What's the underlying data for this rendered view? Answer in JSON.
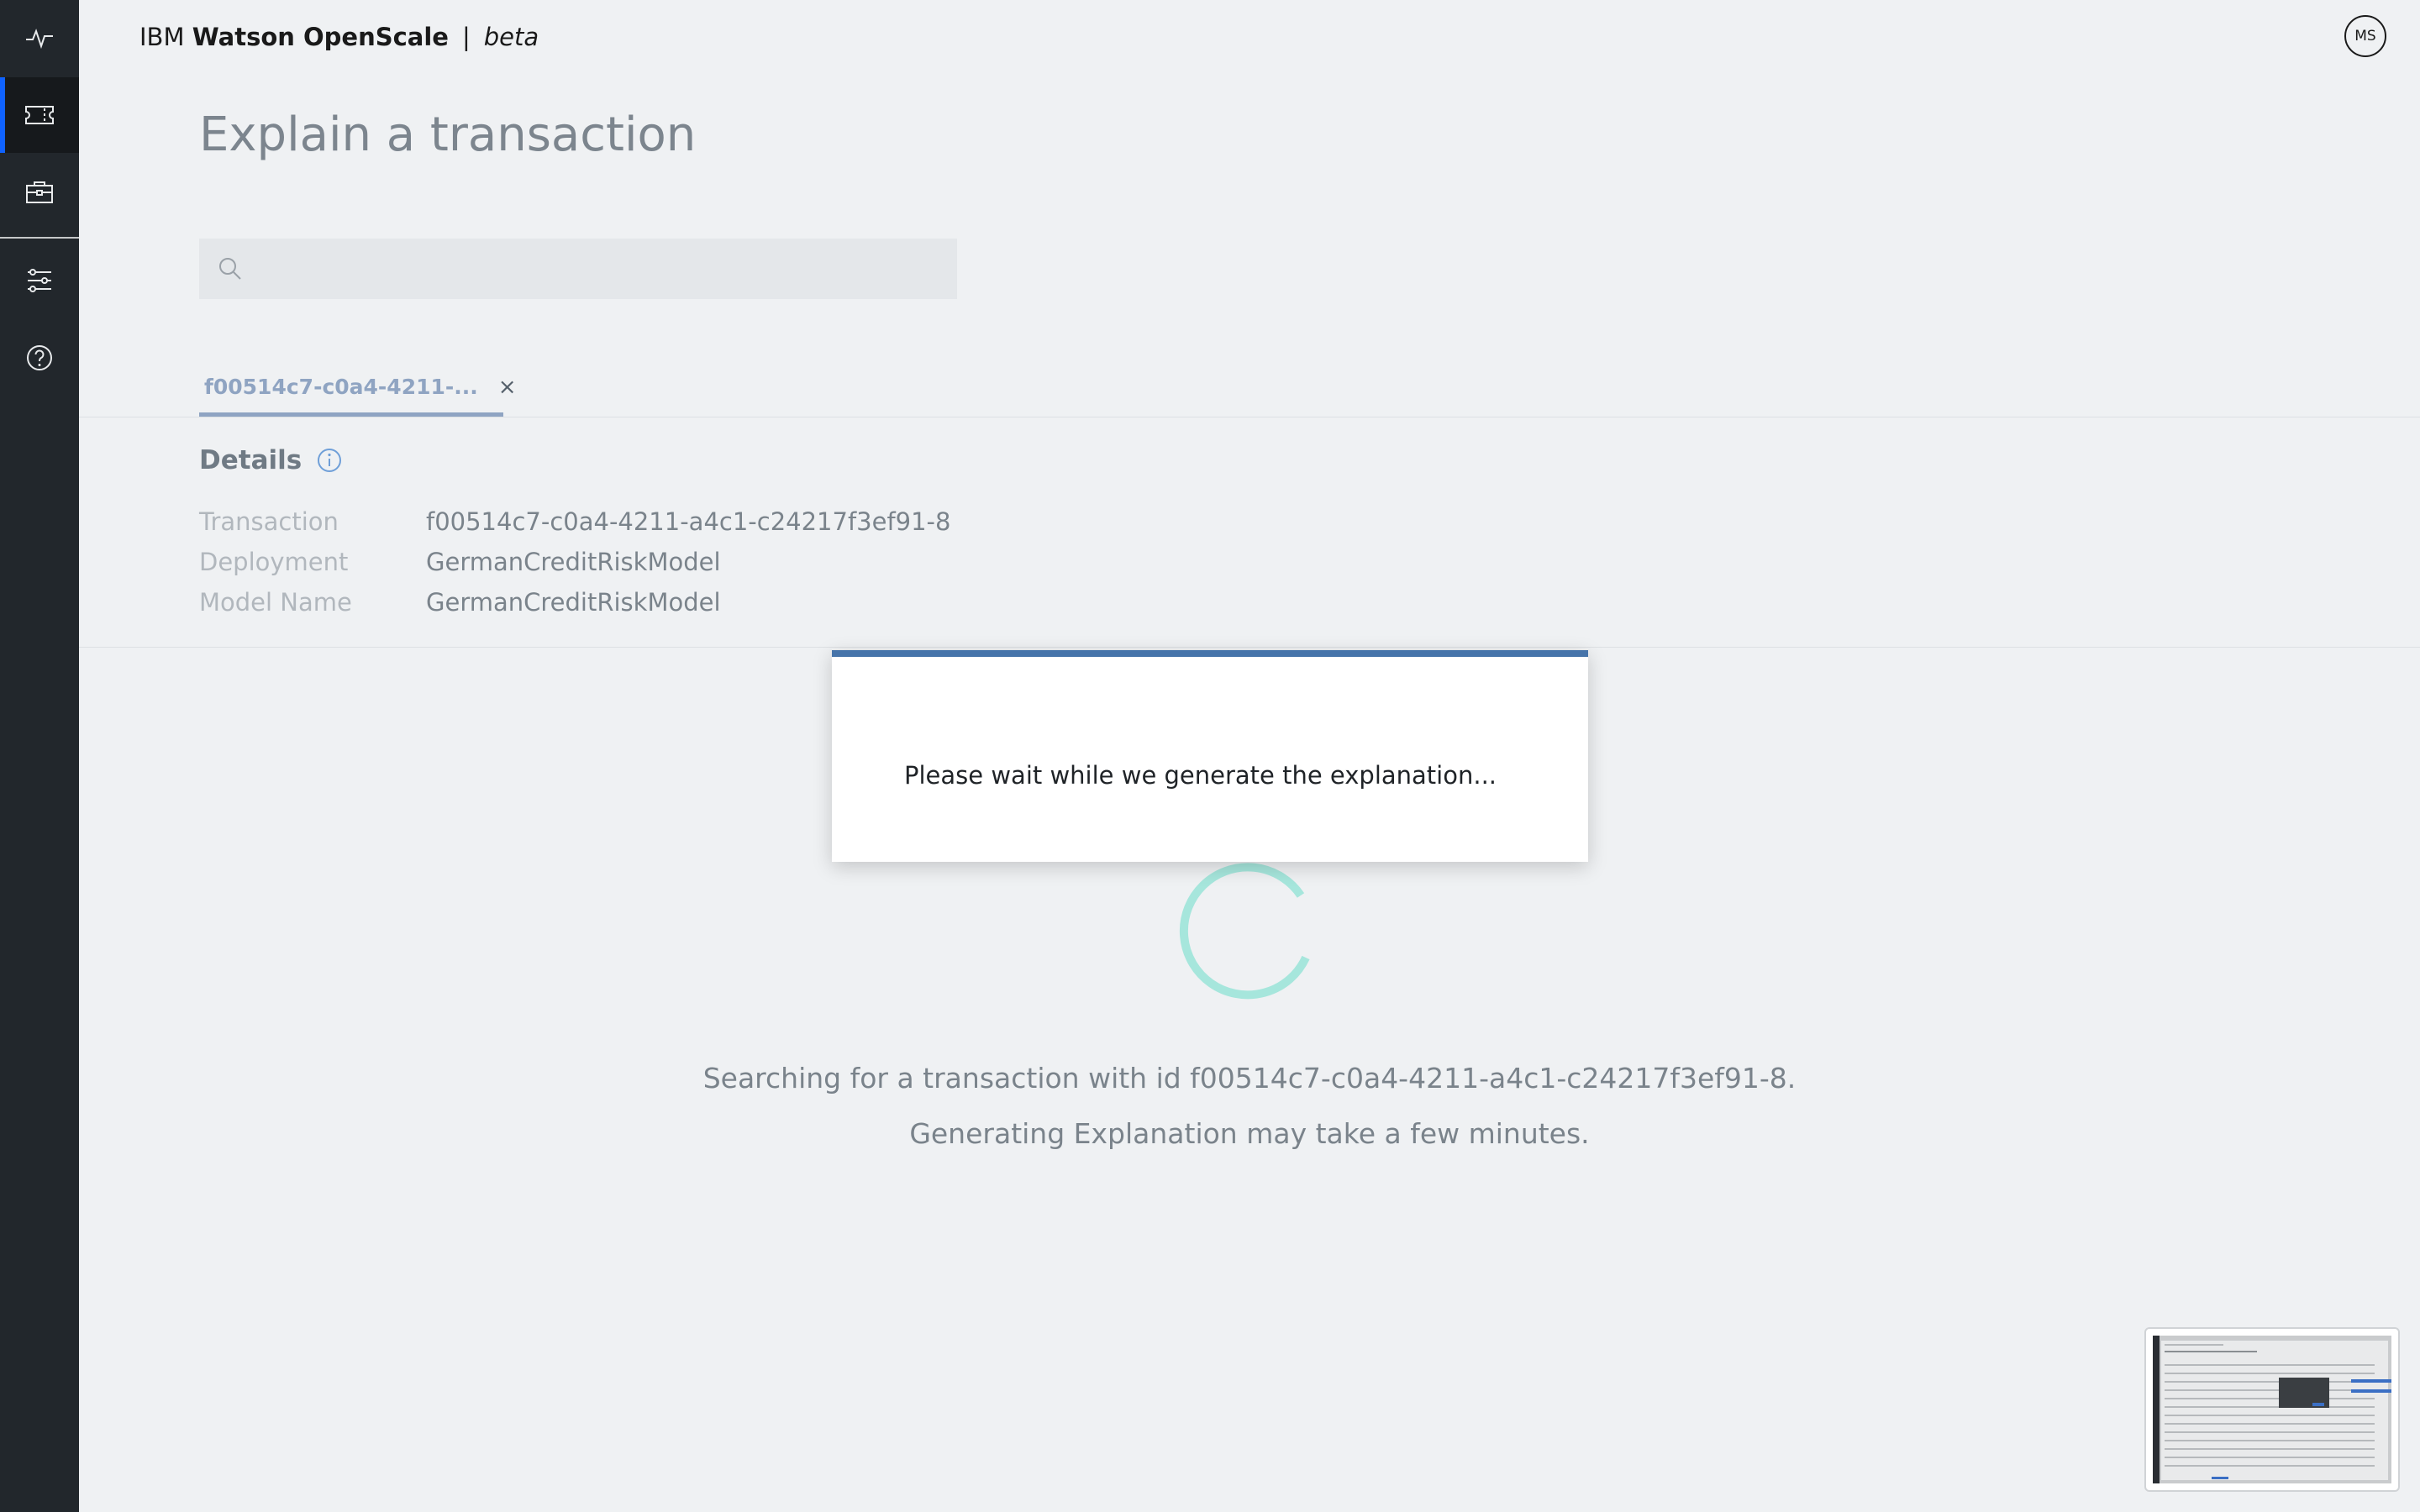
{
  "app": {
    "brand_prefix": "IBM",
    "brand_name": "Watson OpenScale",
    "brand_separator": "|",
    "brand_tag": "beta",
    "user_initials": "MS"
  },
  "rail": {
    "items": [
      {
        "icon": "pulse-icon"
      },
      {
        "icon": "ticket-icon"
      },
      {
        "icon": "briefcase-icon"
      },
      {
        "icon": "sliders-icon"
      },
      {
        "icon": "help-icon"
      }
    ]
  },
  "page": {
    "title": "Explain a transaction"
  },
  "search": {
    "value": "",
    "placeholder": ""
  },
  "tab": {
    "label": "f00514c7-c0a4-4211-...",
    "close": "×"
  },
  "details": {
    "title": "Details",
    "rows": [
      {
        "key": "Transaction",
        "value": "f00514c7-c0a4-4211-a4c1-c24217f3ef91-8"
      },
      {
        "key": "Deployment",
        "value": "GermanCreditRiskModel"
      },
      {
        "key": "Model Name",
        "value": "GermanCreditRiskModel"
      }
    ]
  },
  "status": {
    "line1": "Searching for a transaction with id f00514c7-c0a4-4211-a4c1-c24217f3ef91-8.",
    "line2": "Generating Explanation may take a few minutes."
  },
  "modal": {
    "message": "Please wait while we generate the explanation..."
  },
  "colors": {
    "rail_bg": "#22272c",
    "accent_blue": "#0f62fe",
    "modal_top_border": "#4674aa",
    "spinner_teal": "#a6e6dc",
    "tab_text": "#8fa4c2"
  }
}
